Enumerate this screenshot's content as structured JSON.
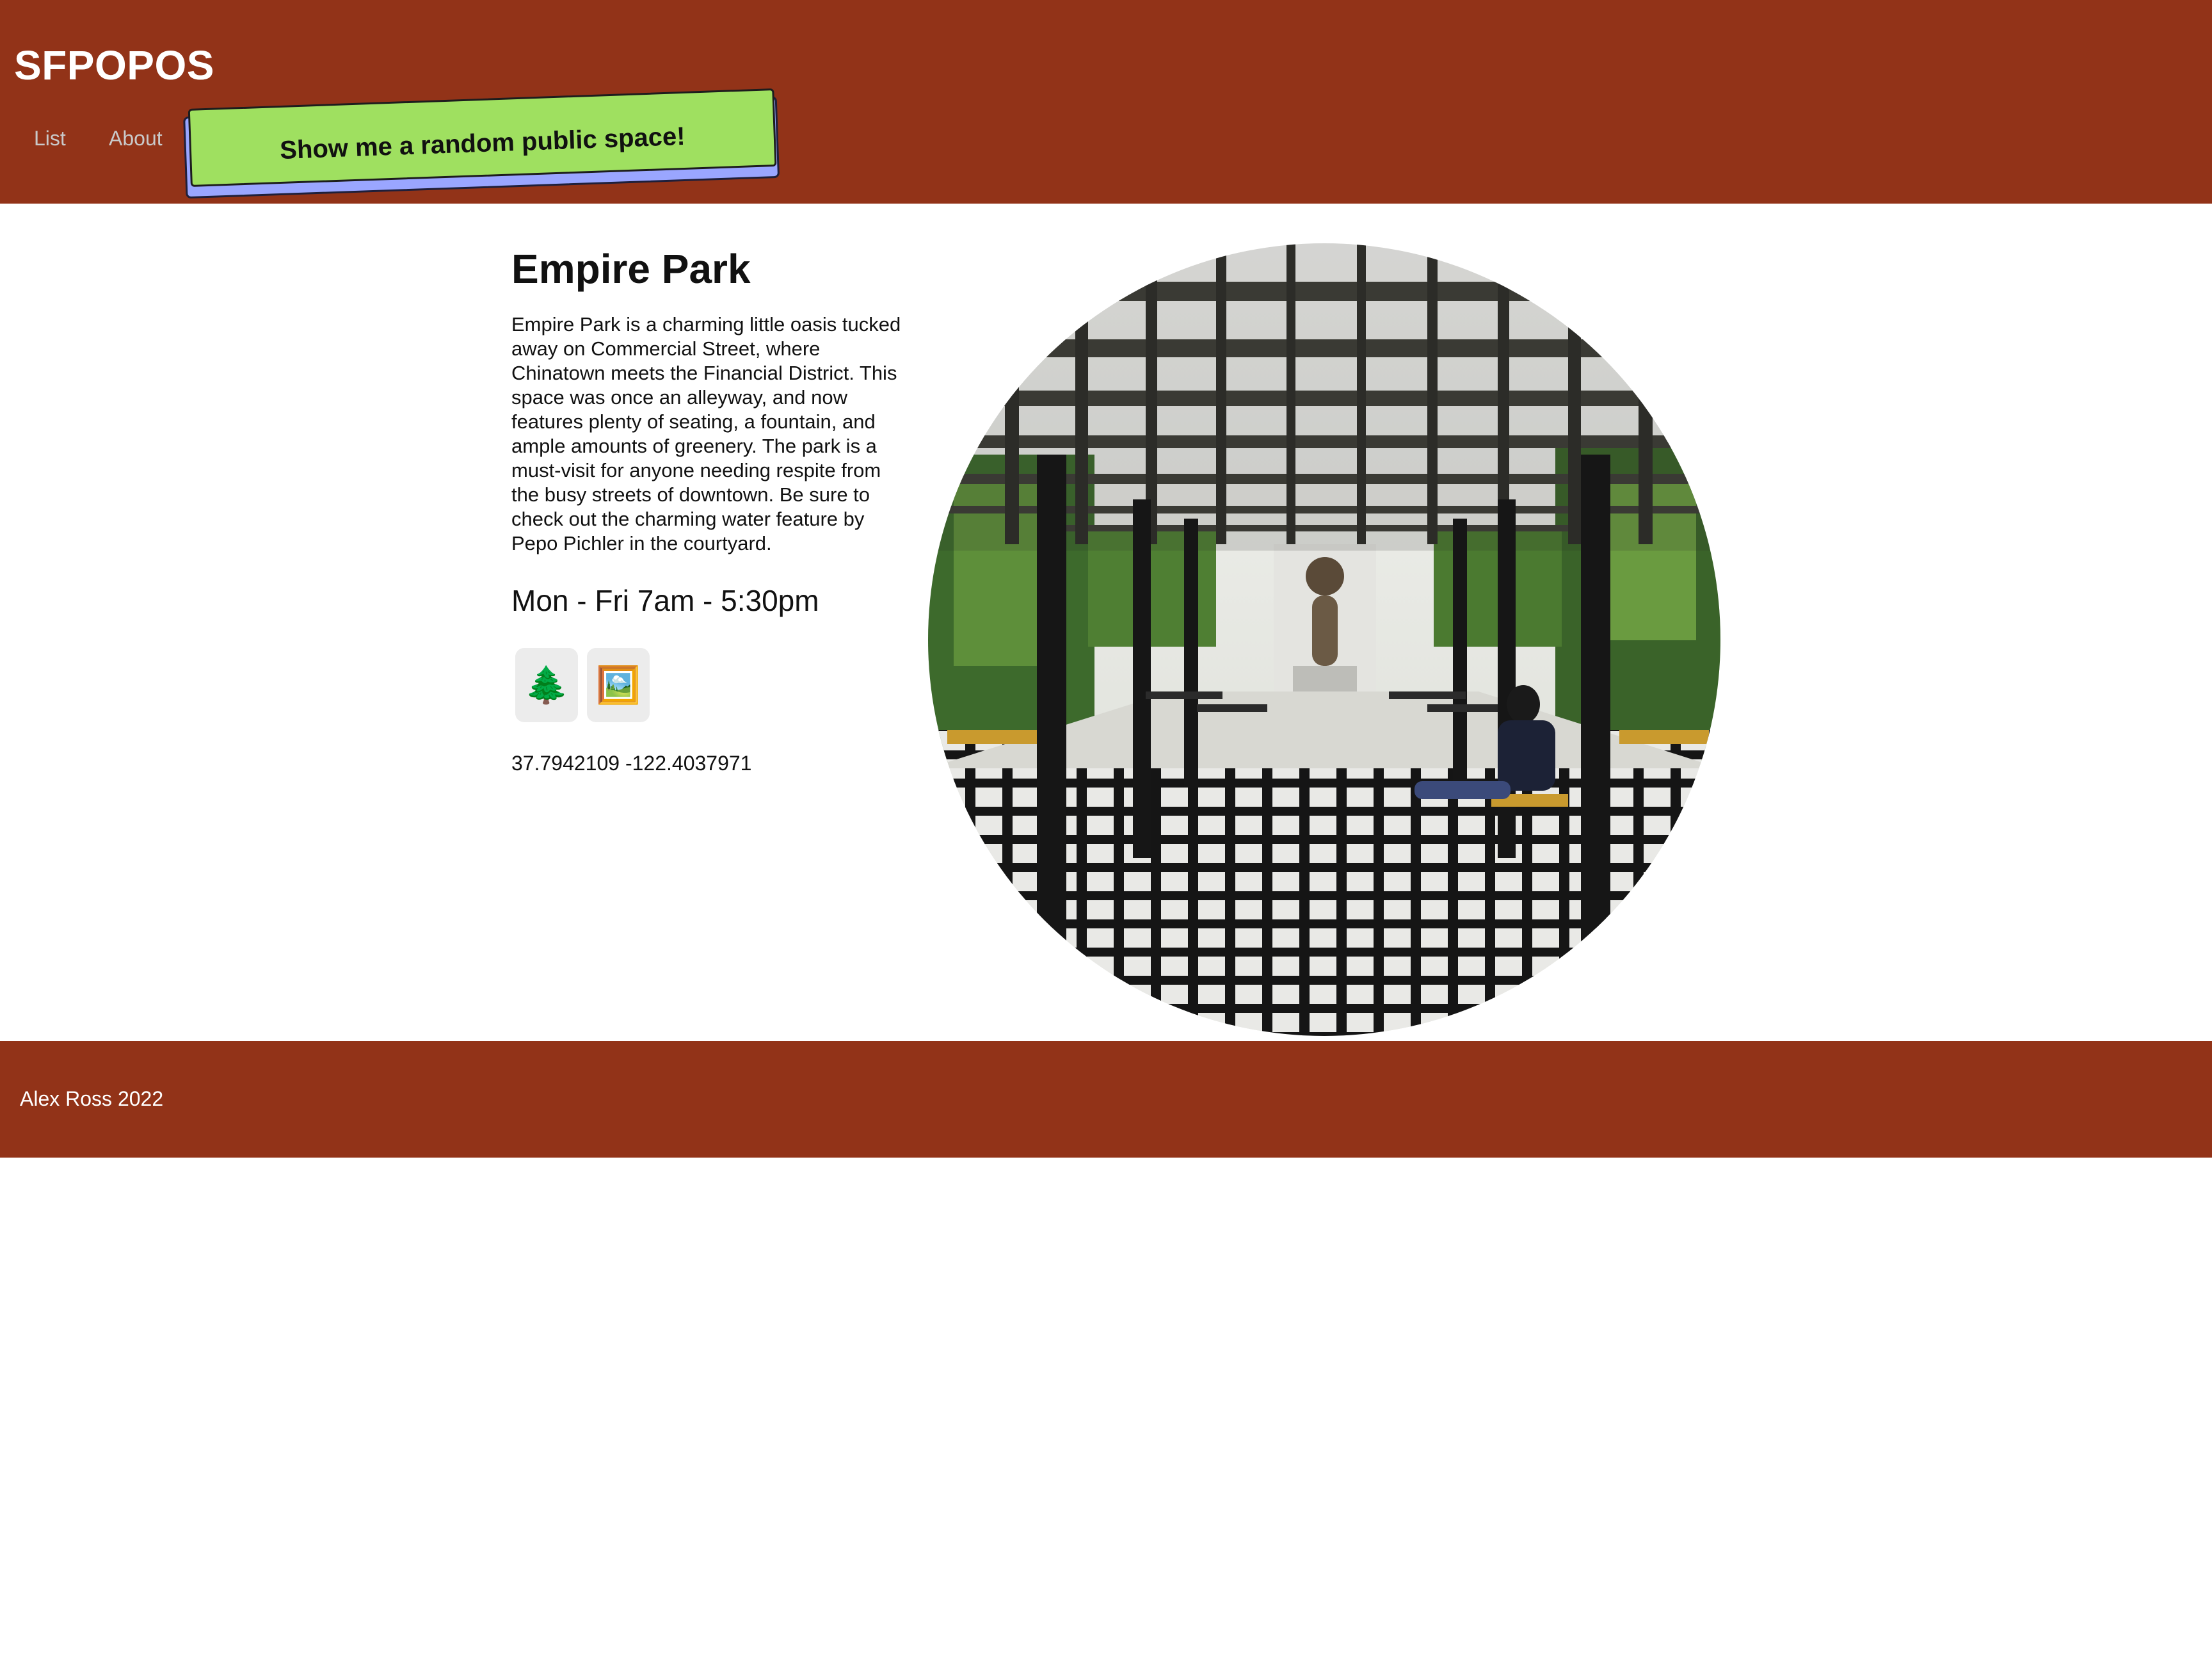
{
  "header": {
    "site_title": "SFPOPOS",
    "nav": {
      "list_label": "List",
      "about_label": "About"
    },
    "random_button_label": "Show me a random public space!",
    "background_color": "#923318"
  },
  "space": {
    "name": "Empire Park",
    "description": "Empire Park is a charming little oasis tucked away on Commercial Street, where Chinatown meets the Financial District. This space was once an alleyway, and now features plenty of seating, a fountain, and ample amounts of greenery. The park is a must-visit for anyone needing respite from the busy streets of downtown. Be sure to check out the charming water feature by Pepo Pichler in the courtyard.",
    "hours": "Mon - Fri 7am - 5:30pm",
    "amenities": [
      {
        "icon": "🌲",
        "icon_name": "evergreen-tree-icon"
      },
      {
        "icon": "🖼️",
        "icon_name": "framed-picture-icon"
      }
    ],
    "coordinates": "37.7942109 -122.4037971",
    "photo_subject": "pergola-courtyard-photo"
  },
  "footer": {
    "credit": "Alex Ross 2022"
  },
  "colors": {
    "brand_rust": "#923318",
    "button_green": "#9fe060",
    "button_shadow": "#9aa6ff",
    "amenity_bg": "#ececec"
  }
}
